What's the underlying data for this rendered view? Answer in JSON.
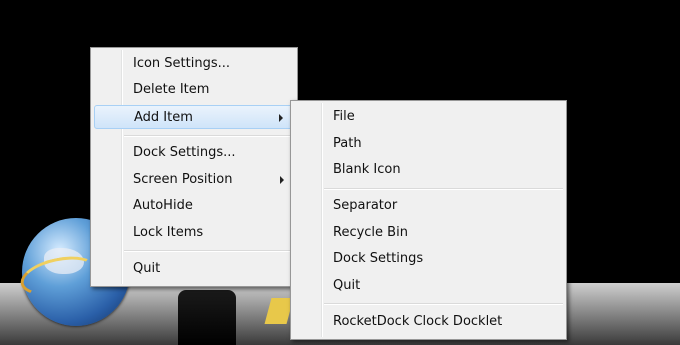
{
  "main_menu": {
    "items": [
      {
        "label": "Icon Settings..."
      },
      {
        "label": "Delete Item"
      },
      {
        "label": "Add Item"
      },
      {
        "label": "Dock Settings..."
      },
      {
        "label": "Screen Position"
      },
      {
        "label": "AutoHide"
      },
      {
        "label": "Lock Items"
      },
      {
        "label": "Quit"
      }
    ]
  },
  "sub_menu": {
    "items": [
      {
        "label": "File"
      },
      {
        "label": "Path"
      },
      {
        "label": "Blank Icon"
      },
      {
        "label": "Separator"
      },
      {
        "label": "Recycle Bin"
      },
      {
        "label": "Dock Settings"
      },
      {
        "label": "Quit"
      },
      {
        "label": "RocketDock Clock Docklet"
      }
    ]
  },
  "colors": {
    "menu_bg": "#f0f0f0",
    "highlight": "#cfe4f9",
    "desktop": "#000000"
  }
}
